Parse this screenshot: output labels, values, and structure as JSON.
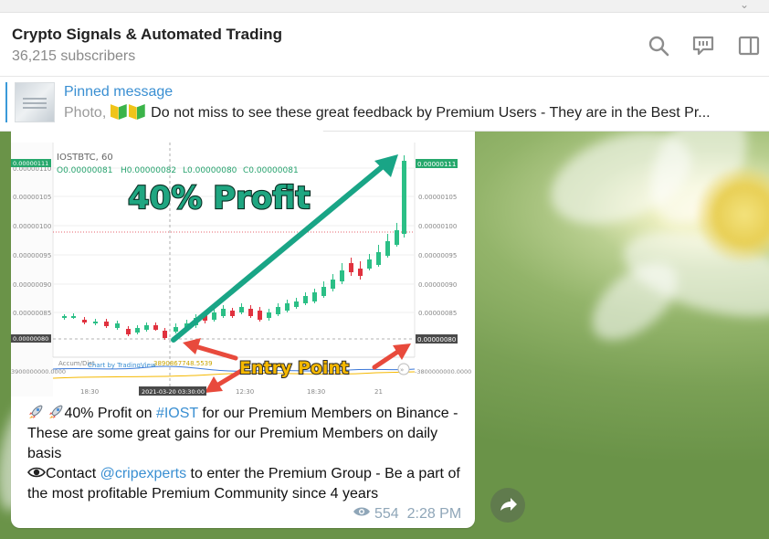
{
  "channel": {
    "title": "Crypto Signals & Automated Trading",
    "subscribers": "36,215 subscribers"
  },
  "header_icons": [
    "search-icon",
    "comments-icon",
    "sidebar-toggle-icon"
  ],
  "pinned": {
    "label": "Pinned message",
    "prefix": "Photo,",
    "text": "Do not miss to see these great feedback by Premium Users - They are in the Best Pr..."
  },
  "chart_image": {
    "symbol": "IOSTBTC, 60",
    "ohlc": {
      "o": "O0.00000081",
      "h": "H0.00000082",
      "l": "L0.00000080",
      "c": "C0.00000081"
    },
    "headline": "40% Profit",
    "entry_label": "Entry Point",
    "attribution": "Chart by TradingView",
    "volume_label": "Accum/Dist",
    "volume_value": "3890867748.5539",
    "vol_right": "-3800000000.0000",
    "vol_left": "3900000000.0000",
    "price_badge_top": "0.00000111",
    "price_badge_bottom": "0.00000080",
    "date_badge": "2021-03-20 03:30:00",
    "y_ticks": [
      "0.00000110",
      "0.00000105",
      "0.00000100",
      "0.00000095",
      "0.00000090",
      "0.00000085"
    ],
    "x_ticks": [
      "18:30",
      "12:30",
      "18:30",
      "21"
    ],
    "colors": {
      "up": "#2bbf86",
      "down": "#e0313e",
      "arrow_green": "#19a586",
      "arrow_red": "#e84a3c",
      "headline_fill": "#1fa681",
      "entry_fill": "#f5b800"
    }
  },
  "message": {
    "line1_pre": "40% Profit on ",
    "hashtag": "#IOST",
    "line1_post": " for our Premium Members on Binance - These are some great gains for our Premium Members on daily basis",
    "line2_pre": "Contact ",
    "mention": "@cripexperts",
    "line2_post": " to enter the Premium Group - Be a part of the most profitable Premium Community since 4 years",
    "views": "554",
    "time": "2:28 PM"
  }
}
